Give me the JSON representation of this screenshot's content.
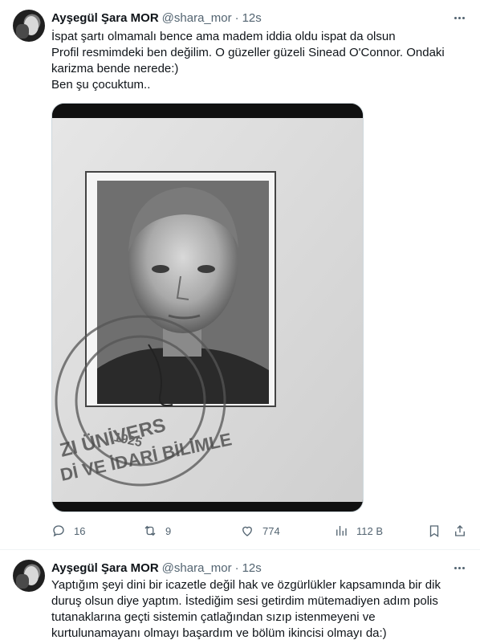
{
  "tweets": [
    {
      "author": {
        "name": "Ayşegül Şara MOR",
        "handle": "@shara_mor",
        "separator": "·",
        "time": "12s"
      },
      "text_lines": [
        "İspat şartı olmamalı bence ama madem iddia oldu ispat da olsun",
        "Profil resmimdeki ben değilim. O güzeller güzeli Sinead O'Connor. Ondaki",
        "karizma bende nerede:)",
        "Ben şu çocuktum.."
      ],
      "media": {
        "stamp_text": "1925 ... ZI ÜNİVERS ... Dİ VE İDARİ BİLİMLE",
        "description_visible": false
      },
      "actions": {
        "replies": "16",
        "retweets": "9",
        "likes": "774",
        "views": "112 B"
      }
    },
    {
      "author": {
        "name": "Ayşegül Şara MOR",
        "handle": "@shara_mor",
        "separator": "·",
        "time": "12s"
      },
      "text_lines": [
        "Yaptığım şeyi dini bir icazetle değil hak ve özgürlükler kapsamında bir dik",
        "duruş olsun diye yaptım. İstediğim sesi getirdim mütemadiyen adım polis",
        "tutanaklarına geçti sistemin çatlağından sızıp istenmeyeni ve",
        "kurtulunamayanı olmayı başardım ve bölüm ikincisi olmayı da:)"
      ]
    }
  ],
  "icons": [
    "more-icon",
    "reply-icon",
    "retweet-icon",
    "like-icon",
    "views-icon",
    "bookmark-icon",
    "share-icon"
  ],
  "colors": {
    "text": "#0f1419",
    "secondary": "#536471",
    "border": "#eff3f4"
  }
}
